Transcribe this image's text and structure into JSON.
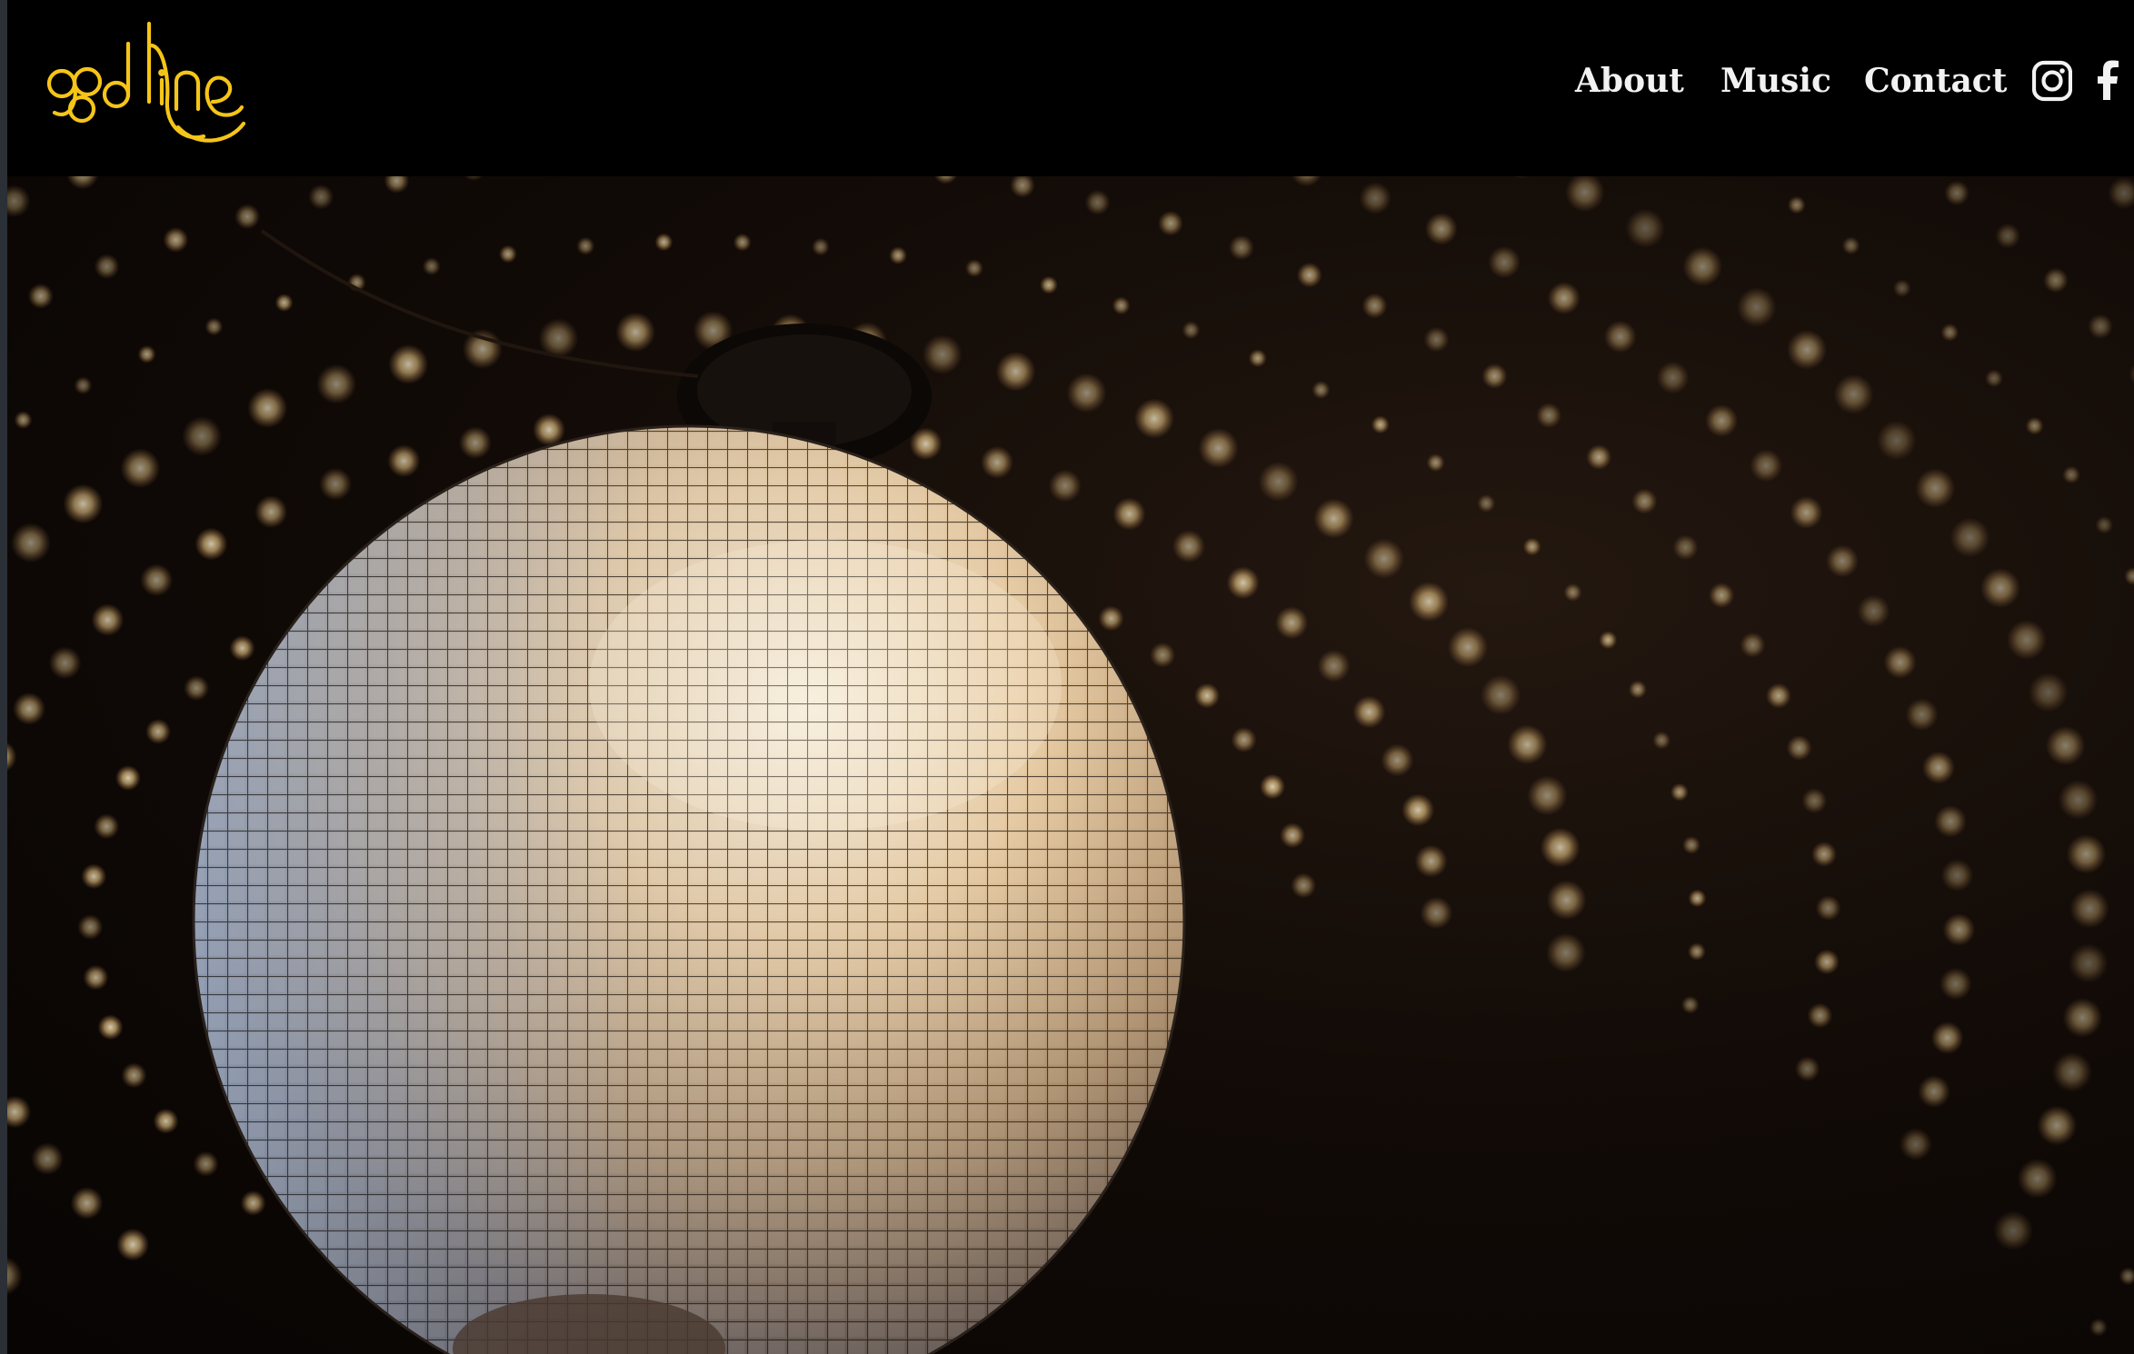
{
  "brand": {
    "name": "goodline",
    "logo_color": "#f5c518"
  },
  "nav": {
    "items": [
      {
        "label": "About"
      },
      {
        "label": "Music"
      },
      {
        "label": "Contact"
      }
    ]
  },
  "social": {
    "instagram_icon": "instagram-icon",
    "facebook_icon": "facebook-icon"
  },
  "hero": {
    "subject": "disco-ball-image",
    "colors": {
      "background": "#0c0705",
      "light_spot": "#ffe6b0",
      "ball_warm": "#e7c79a",
      "ball_cool": "#9fb6d8"
    }
  }
}
